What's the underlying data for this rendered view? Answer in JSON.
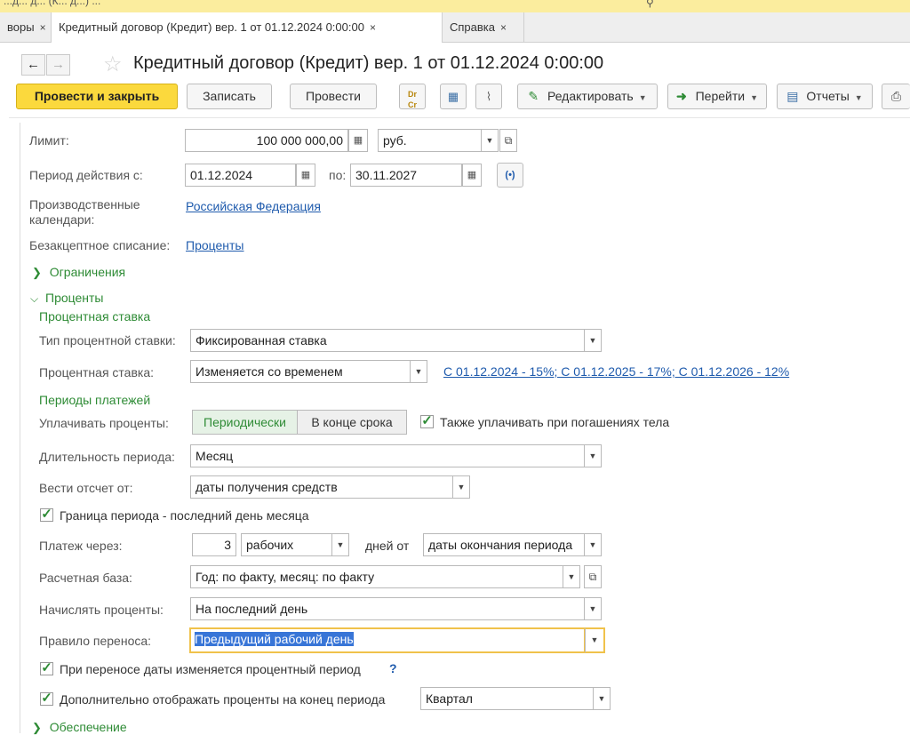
{
  "topbar": {
    "partial_text": "...д... д... (К... д...) ..."
  },
  "tabs": [
    {
      "label": "воры"
    },
    {
      "label": "Кредитный договор (Кредит) вер. 1 от 01.12.2024 0:00:00"
    },
    {
      "label": "Справка"
    }
  ],
  "tab_close_glyph": "×",
  "title": "Кредитный договор (Кредит) вер. 1 от 01.12.2024 0:00:00",
  "toolbar": {
    "post_close": "Провести и закрыть",
    "save": "Записать",
    "post": "Провести",
    "dtct_icon": "Dr\nCr",
    "edit": "Редактировать",
    "goto": "Перейти",
    "reports": "Отчеты"
  },
  "form": {
    "limit_label": "Лимит:",
    "limit_value": "100 000 000,00",
    "currency": "руб.",
    "period_label": "Период действия с:",
    "period_from": "01.12.2024",
    "period_to_label": "по:",
    "period_to": "30.11.2027",
    "calendars_label_1": "Производственные",
    "calendars_label_2": "календари:",
    "calendars_value": "Российская Федерация",
    "acceptance_label": "Безакцептное списание:",
    "acceptance_value": "Проценты",
    "restrictions": "Ограничения",
    "interest": "Проценты",
    "rate_section": "Процентная ставка",
    "rate_type_label": "Тип процентной ставки:",
    "rate_type_value": "Фиксированная ставка",
    "rate_label": "Процентная ставка:",
    "rate_value": "Изменяется со временем",
    "rate_link": "С 01.12.2024 - 15%; С 01.12.2025 - 17%; С 01.12.2026 - 12%",
    "payments_section": "Периоды платежей",
    "pay_label": "Уплачивать проценты:",
    "pay_periodic": "Периодически",
    "pay_end": "В конце срока",
    "also_pay": "Также уплачивать при погашениях тела",
    "duration_label": "Длительность периода:",
    "duration_value": "Месяц",
    "count_from_label": "Вести отсчет от:",
    "count_from_value": "даты получения средств",
    "boundary": "Граница периода - последний день месяца",
    "payment_via_label": "Платеж через:",
    "payment_days": "3",
    "payment_day_type": "рабочих",
    "days_from_label": "дней от",
    "days_from_value": "даты окончания периода",
    "calc_base_label": "Расчетная база:",
    "calc_base_value": "Год: по факту, месяц: по факту",
    "accrue_label": "Начислять проценты:",
    "accrue_value": "На последний день",
    "transfer_label": "Правило переноса:",
    "transfer_value": "Предыдущий рабочий день",
    "transfer_change": "При переносе даты изменяется процентный период",
    "help_mark": "?",
    "show_interest": "Дополнительно отображать проценты на конец периода",
    "quarter_value": "Квартал",
    "collateral": "Обеспечение"
  },
  "colors": {
    "primary_button": "#fbd93d",
    "accent_green": "#2e8b35",
    "link_blue": "#1f5bad",
    "highlight": "#3875d7",
    "focus_border": "#f0c24b"
  }
}
